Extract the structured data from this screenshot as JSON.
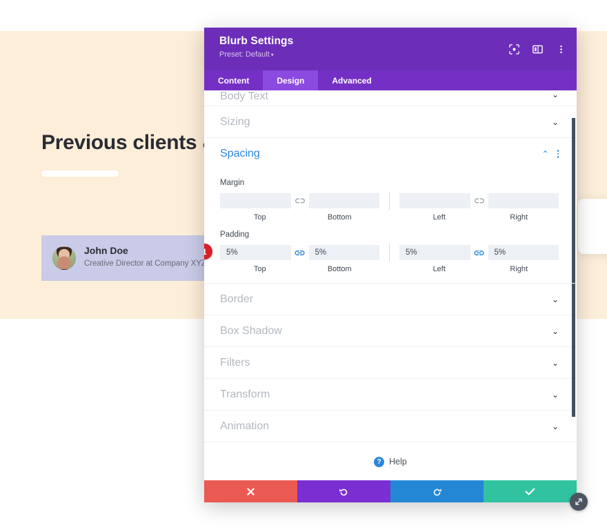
{
  "background": {
    "heading": "Previous clients & the",
    "testimonial": {
      "name": "John Doe",
      "role": "Creative Director at Company XYZ",
      "avatar_icon": "person-avatar"
    }
  },
  "modal": {
    "title": "Blurb Settings",
    "preset_label": "Preset: Default",
    "preset_caret": "▾",
    "header_icons": [
      {
        "name": "focus-target-icon"
      },
      {
        "name": "panel-layout-icon"
      },
      {
        "name": "overflow-menu-icon"
      }
    ],
    "tabs": [
      {
        "label": "Content",
        "active": false
      },
      {
        "label": "Design",
        "active": true
      },
      {
        "label": "Advanced",
        "active": false
      }
    ],
    "sections": {
      "body_text": {
        "label": "Body Text",
        "expanded": false,
        "chevron": "⌄"
      },
      "sizing": {
        "label": "Sizing",
        "expanded": false,
        "chevron": "⌄"
      },
      "spacing": {
        "label": "Spacing",
        "expanded": true,
        "chevron": "⌃"
      },
      "border": {
        "label": "Border",
        "expanded": false,
        "chevron": "⌄"
      },
      "box_shadow": {
        "label": "Box Shadow",
        "expanded": false,
        "chevron": "⌄"
      },
      "filters": {
        "label": "Filters",
        "expanded": false,
        "chevron": "⌄"
      },
      "transform": {
        "label": "Transform",
        "expanded": false,
        "chevron": "⌄"
      },
      "animation": {
        "label": "Animation",
        "expanded": false,
        "chevron": "⌄"
      }
    },
    "spacing": {
      "margin": {
        "group_label": "Margin",
        "linked": false,
        "link_icon": "chain-broken-icon",
        "top": {
          "value": "",
          "placeholder": "",
          "label": "Top"
        },
        "bottom": {
          "value": "",
          "placeholder": "",
          "label": "Bottom"
        },
        "left": {
          "value": "",
          "placeholder": "",
          "label": "Left"
        },
        "right": {
          "value": "",
          "placeholder": "",
          "label": "Right"
        }
      },
      "padding": {
        "group_label": "Padding",
        "linked": true,
        "link_icon": "chain-linked-icon",
        "top": {
          "value": "5%",
          "placeholder": "",
          "label": "Top"
        },
        "bottom": {
          "value": "5%",
          "placeholder": "",
          "label": "Bottom"
        },
        "left": {
          "value": "5%",
          "placeholder": "",
          "label": "Left"
        },
        "right": {
          "value": "5%",
          "placeholder": "",
          "label": "Right"
        }
      },
      "step_badge": "1"
    },
    "help": {
      "label": "Help",
      "icon": "question-circle-icon"
    },
    "footer_buttons": [
      {
        "name": "cancel-button",
        "icon": "close-x-icon",
        "color": "#eb5a52"
      },
      {
        "name": "undo-button",
        "icon": "undo-arrow-icon",
        "color": "#7b2ed1"
      },
      {
        "name": "redo-button",
        "icon": "redo-arrow-icon",
        "color": "#2387d6"
      },
      {
        "name": "save-button",
        "icon": "checkmark-icon",
        "color": "#31c2a0"
      }
    ],
    "resize_handle_icon": "diagonal-resize-icon",
    "colors": {
      "header_purple": "#6c2eb9",
      "tabbar_purple": "#7430c4",
      "active_tab_purple": "#8b4ae0",
      "accent_blue": "#2b87da",
      "badge_red": "#d81f26",
      "page_peach": "#fdeed9",
      "card_lavender": "#c9cbe8"
    }
  }
}
